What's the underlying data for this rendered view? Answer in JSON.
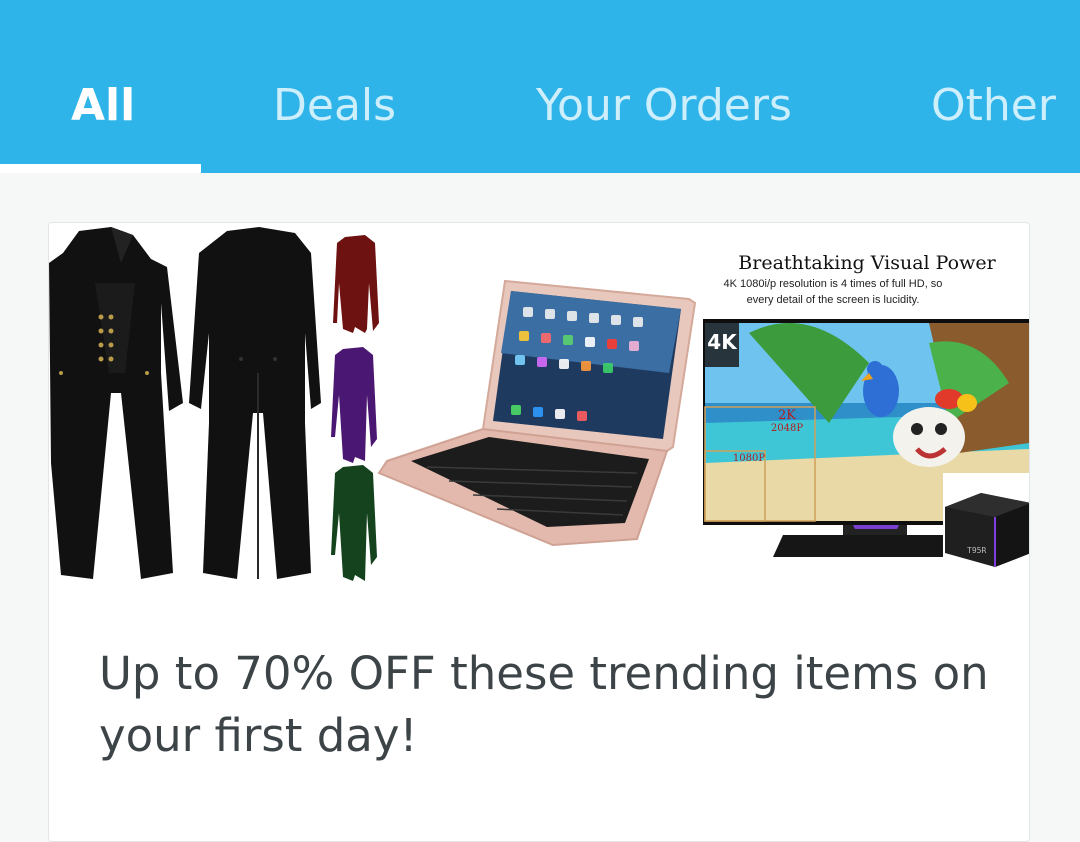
{
  "tabs": [
    {
      "label": "All",
      "active": true
    },
    {
      "label": "Deals",
      "active": false
    },
    {
      "label": "Your Orders",
      "active": false
    },
    {
      "label": "Other",
      "active": false
    }
  ],
  "colors": {
    "header": "#2fb4ea",
    "active_tab": "#ffffff",
    "inactive_tab": "#cdeefb",
    "body_text": "#3d4448"
  },
  "promo": {
    "banner": {
      "tv_headline": "Breathtaking Visual Power",
      "tv_subtext_line1": "4K 1080i/p resolution is 4 times of full HD, so",
      "tv_subtext_line2": "every detail of the screen is lucidity.",
      "res_4k": "4K",
      "res_2k": "2K",
      "res_2048": "2048P",
      "res_1080": "1080P",
      "box_label": "T95R"
    },
    "text": "Up to 70% OFF these trending items on your first day!"
  }
}
